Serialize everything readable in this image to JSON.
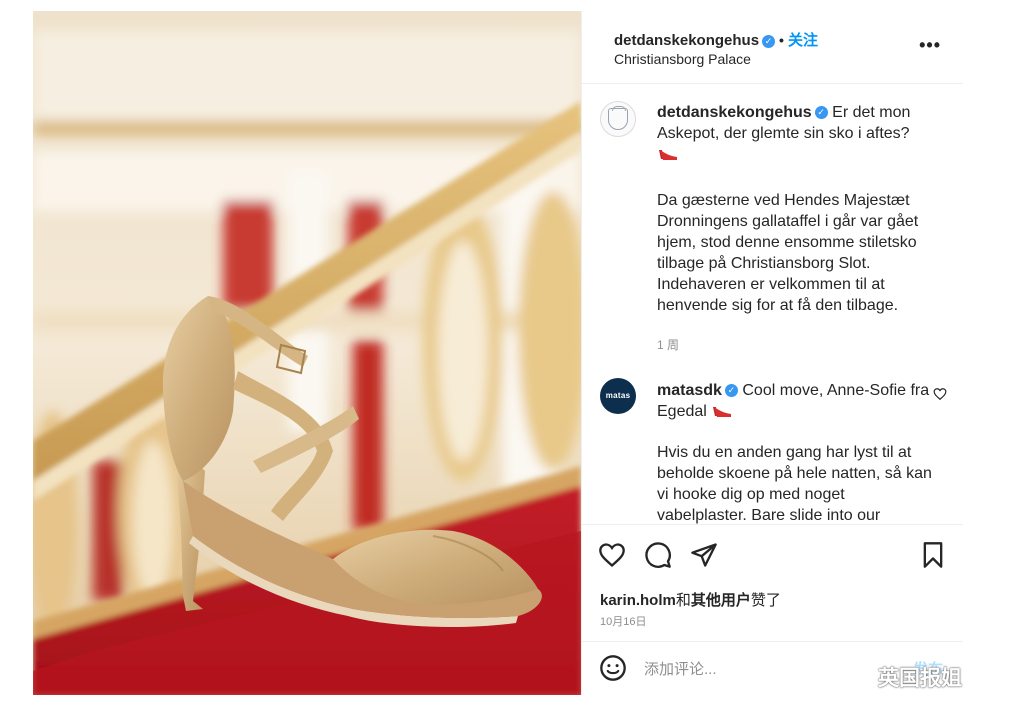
{
  "header": {
    "username": "detdanskekongehus",
    "follow_label": "关注",
    "separator": "•",
    "location": "Christiansborg Palace",
    "more_label": "•••"
  },
  "caption": {
    "username": "detdanskekongehus",
    "text_line": "Er det mon Askepot, der glemte sin sko i aftes?",
    "body": "Da gæsterne ved Hendes Majestæt Dronningens gallataffel i går var gået hjem, stod denne ensomme stiletsko tilbage på Christiansborg Slot. Indehaveren er velkommen til at henvende sig for at få den tilbage.",
    "time": "1 周",
    "emoji": "high-heel-shoe-emoji"
  },
  "reply": {
    "avatar_text": "matas",
    "username": "matasdk",
    "text_line": "Cool move, Anne-Sofie fra Egedal",
    "body": "Hvis du en anden gang har lyst til at beholde skoene på hele natten, så kan vi hooke dig op med noget vabelplaster. Bare slide into our",
    "emoji": "high-heel-shoe-emoji"
  },
  "actions": {
    "likes_user": "karin.holm",
    "likes_and": "和",
    "likes_others": "其他用户",
    "likes_suffix": "赞了",
    "date": "10月16日"
  },
  "add_comment": {
    "placeholder": "添加评论...",
    "post_label": "发布"
  },
  "watermark": {
    "text": "英国报姐"
  },
  "colors": {
    "accent": "#0095f6",
    "verified": "#3897f0",
    "carpet": "#b3121b"
  }
}
